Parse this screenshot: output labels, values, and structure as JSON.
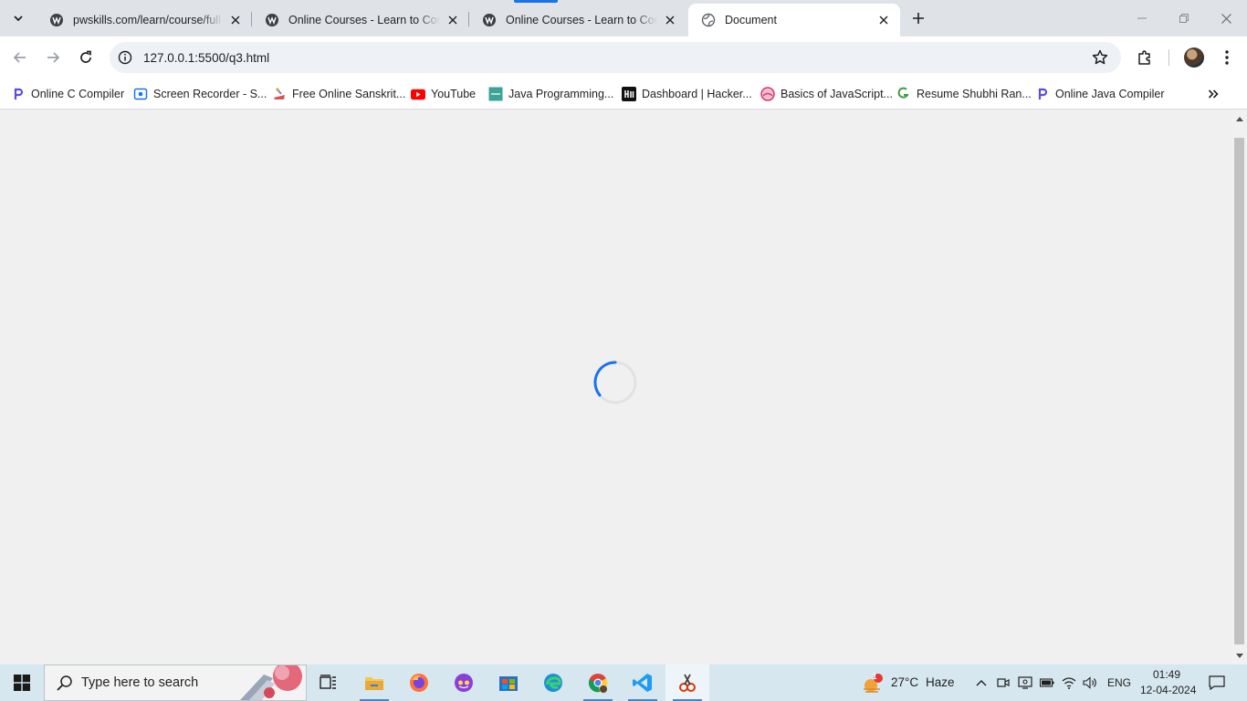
{
  "browser": {
    "tabs": [
      {
        "title": "pwskills.com/learn/course/full-s",
        "active": false
      },
      {
        "title": "Online Courses - Learn to Code",
        "active": false
      },
      {
        "title": "Online Courses - Learn to Code",
        "active": false
      },
      {
        "title": "Document",
        "active": true
      }
    ],
    "address": "127.0.0.1:5500/q3.html",
    "bookmarks": [
      {
        "label": "Online C Compiler",
        "icon": "p-logo-icon"
      },
      {
        "label": "Screen Recorder - S...",
        "icon": "recorder-icon"
      },
      {
        "label": "Free Online Sanskrit...",
        "icon": "sanskrit-icon"
      },
      {
        "label": "YouTube",
        "icon": "youtube-icon"
      },
      {
        "label": "Java Programming...",
        "icon": "java-icon"
      },
      {
        "label": "Dashboard | Hacker...",
        "icon": "hackerrank-icon"
      },
      {
        "label": "Basics of JavaScript...",
        "icon": "js-basics-icon"
      },
      {
        "label": "Resume Shubhi Ran...",
        "icon": "resume-icon"
      },
      {
        "label": "Online Java Compiler",
        "icon": "p-logo-icon"
      }
    ]
  },
  "page": {
    "state": "loading",
    "spinner_color": "#1a73e8"
  },
  "taskbar": {
    "search_placeholder": "Type here to search",
    "weather": {
      "temp": "27°C",
      "condition": "Haze",
      "badge": "1"
    },
    "language": "ENG",
    "time": "01:49",
    "date": "12-04-2024",
    "apps": [
      "task-view",
      "file-explorer",
      "firefox",
      "messenger",
      "store",
      "edge",
      "chrome",
      "vscode",
      "snipping-tool"
    ]
  },
  "colors": {
    "tabstrip": "#dfe3e8",
    "omnibox": "#eef1f5",
    "taskbar": "#d7e7f0",
    "accent": "#1a73e8"
  }
}
